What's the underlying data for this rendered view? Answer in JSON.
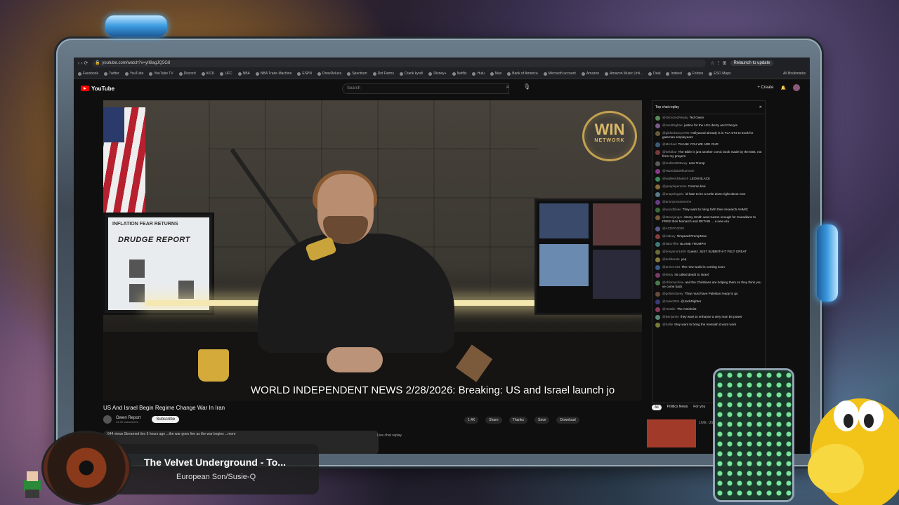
{
  "browser": {
    "url": "youtube.com/watch?v=yII8agJQ5G8",
    "relaunch_label": "Relaunch to update",
    "bookmarks": [
      "Facebook",
      "Twitter",
      "YouTube",
      "YouTube TV",
      "Discord",
      "KICK",
      "UFC",
      "NBA",
      "NBA Trade Machine",
      "ESPN",
      "DrewDeluca",
      "Spectrum",
      "Dot Farms",
      "Crank kyrell",
      "Disney+",
      "Netflix",
      "Hulu",
      "Max",
      "Bank of America",
      "Microsoft account",
      "Amazon",
      "Amazon Music Unli...",
      "Deal",
      "Indeed",
      "Forbes",
      "ESO Maps"
    ],
    "all_bookmarks_label": "All Bookmarks"
  },
  "youtube": {
    "logo_text": "YouTube",
    "search_placeholder": "Search",
    "create_label": "+ Create",
    "video_title": "US And Israel Begin Regime Change War In Iran",
    "channel_name": "Owen Report",
    "channel_subs": "44.3K subscribers",
    "subscribe_label": "Subscribe",
    "actions": [
      "1.4K",
      "Share",
      "Thanks",
      "Save",
      "Download"
    ],
    "description": "644 views  Streamed live 5 hours ago  ...the war goes live as the war begins ...more",
    "live_chat_replay_label": "Live chat replay",
    "ticker": "WORLD INDEPENDENT NEWS 2/28/2026: Breaking: US and Israel launch jo",
    "win_logo": {
      "big": "WIN",
      "small": "NETWORK"
    },
    "drudge": {
      "headline": "INFLATION FEAR RETURNS",
      "title": "DRUDGE REPORT"
    }
  },
  "chat": {
    "header_label": "Top chat replay",
    "messages": [
      {
        "name": "@Gilmore2Ready",
        "text": "Ted Owen",
        "color": "#5a8a5a"
      },
      {
        "name": "@JackRighter",
        "text": "justice for the US Liberty and Cheryle",
        "color": "#7a5a8a"
      },
      {
        "name": "@gilderdavey2780",
        "text": "Hollywood already is in FLA ST3 to book for gateman simpleyears",
        "color": "#6a5a3a"
      },
      {
        "name": "@Michael",
        "text": "THANK YOU WE ARE OUR",
        "color": "#3a5a7a"
      },
      {
        "name": "@kekkkar",
        "text": "The Bible is just another comic book made by the EBs, not from my prayers",
        "color": "#7a3a3a"
      },
      {
        "name": "@mollar3008way",
        "text": "Lets Trump",
        "color": "#5a5a5a"
      },
      {
        "name": "@Hamidabdelkarimah",
        "text": "",
        "color": "#8a3a8a"
      },
      {
        "name": "@walleerdvlasech",
        "text": "LEON BLACK",
        "color": "#3a8a5a"
      },
      {
        "name": "@josephpersons",
        "text": "Comme kiwi",
        "color": "#8a6a3a"
      },
      {
        "name": "@unapologetic",
        "text": "id hate to be a turtle down right about now",
        "color": "#5a7a8a"
      },
      {
        "name": "@anonymousmeme",
        "text": "",
        "color": "#6a3a8a"
      },
      {
        "name": "@woodblake",
        "text": "They want to bring forth their research AHMIC",
        "color": "#3a6a3a"
      },
      {
        "name": "@stevejunger",
        "text": "Jimmy Smith was reason enough for Canadians to FREE their Monarch and RETAIN ... a new era",
        "color": "#7a5a3a"
      },
      {
        "name": "@ACDFG2020",
        "text": "",
        "color": "#5a5a8a"
      },
      {
        "name": "@rodney",
        "text": "#impeachTrumpNow",
        "color": "#8a3a3a"
      },
      {
        "name": "@NESTfhe",
        "text": "BLAME TRUMP!!!",
        "color": "#3a7a7a"
      },
      {
        "name": "@benjamin1609",
        "text": "Guess I JUST SUBMITH IT FELT GREAT",
        "color": "#6a6a3a"
      },
      {
        "name": "@deliberate",
        "text": "yep",
        "color": "#8a7a3a"
      },
      {
        "name": "@anne1723",
        "text": "The new world is coming soon",
        "color": "#3a5a8a"
      },
      {
        "name": "@kirsty",
        "text": "Its called death to Israel",
        "color": "#7a3a6a"
      },
      {
        "name": "@chlomachine",
        "text": "and the Christians are helping them so they think you ve come back",
        "color": "#4a7a4a"
      },
      {
        "name": "@gelderdavey",
        "text": "They must have Pakistan ready to go",
        "color": "#6a4a3a"
      },
      {
        "name": "@Julie2004",
        "text": "@JackRighter",
        "color": "#3a3a7a"
      },
      {
        "name": "@Hostile",
        "text": "The Antichrist",
        "color": "#8a3a5a"
      },
      {
        "name": "@Benjamin",
        "text": "they want to enhance a very man be power",
        "color": "#5a8a7a"
      },
      {
        "name": "@hallie",
        "text": "they want to bring the messiah it wont work",
        "color": "#7a7a3a"
      }
    ],
    "tabs": [
      "All",
      "Politics News",
      "For you"
    ],
    "rec_label": "LIVE: US & ISRAEL STRIKE IRAN"
  },
  "now_playing": {
    "title": "The Velvet Underground - To...",
    "subtitle": "European Son/Susie-Q"
  }
}
